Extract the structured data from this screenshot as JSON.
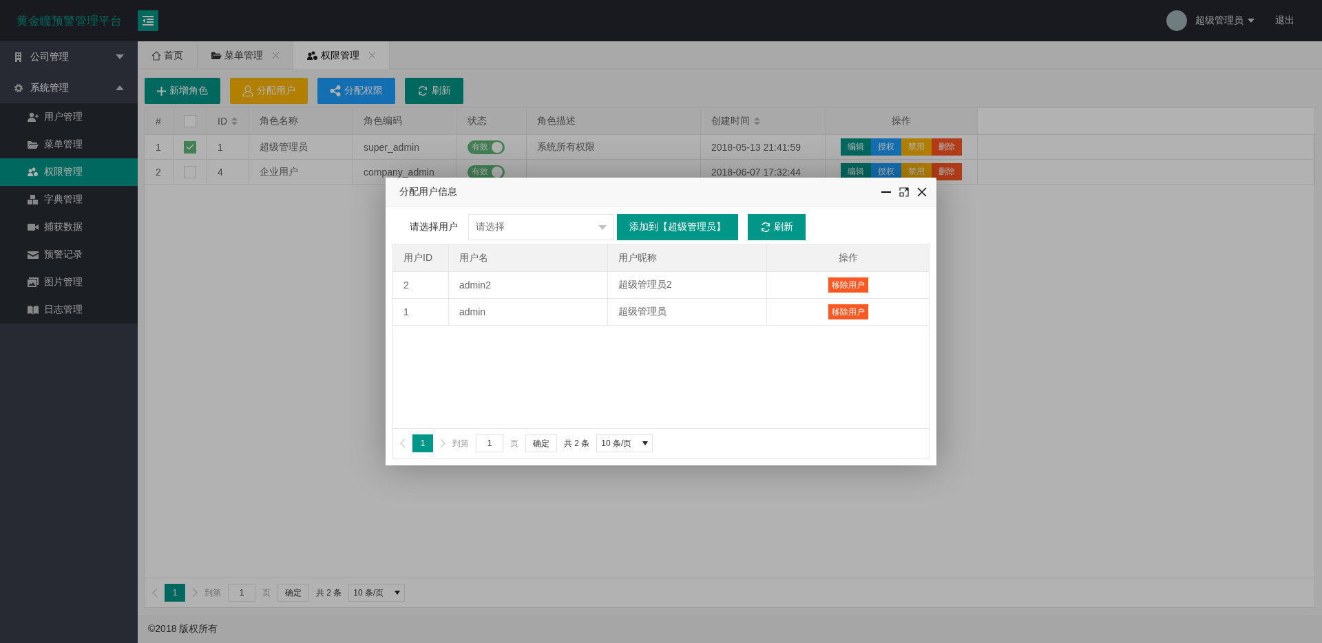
{
  "app": {
    "title": "黄金瞳预警管理平台"
  },
  "user": {
    "name": "超级管理员",
    "logout": "退出"
  },
  "sidebar": {
    "items": [
      {
        "label": "公司管理",
        "expanded": false
      },
      {
        "label": "系统管理",
        "expanded": true,
        "children": [
          {
            "label": "用户管理",
            "selected": false
          },
          {
            "label": "菜单管理",
            "selected": false
          },
          {
            "label": "权限管理",
            "selected": true
          },
          {
            "label": "字典管理",
            "selected": false
          },
          {
            "label": "捕获数据",
            "selected": false
          },
          {
            "label": "预警记录",
            "selected": false
          },
          {
            "label": "图片管理",
            "selected": false
          },
          {
            "label": "日志管理",
            "selected": false
          }
        ]
      }
    ]
  },
  "tabs": [
    {
      "label": "首页",
      "closable": false,
      "selected": false
    },
    {
      "label": "菜单管理",
      "closable": true,
      "selected": false
    },
    {
      "label": "权限管理",
      "closable": true,
      "selected": true
    }
  ],
  "toolbar": [
    {
      "label": "新增角色",
      "kind": "primary"
    },
    {
      "label": "分配用户",
      "kind": "warm"
    },
    {
      "label": "分配权限",
      "kind": "normal"
    },
    {
      "label": "刷新",
      "kind": "primary"
    }
  ],
  "table": {
    "header_checked": false,
    "columns": [
      {
        "label": "#",
        "sortable": false
      },
      {
        "label": "ID",
        "sortable": true
      },
      {
        "label": "角色名称",
        "sortable": false
      },
      {
        "label": "角色编码",
        "sortable": false
      },
      {
        "label": "状态",
        "sortable": false
      },
      {
        "label": "角色描述",
        "sortable": false
      },
      {
        "label": "创建时间",
        "sortable": true
      },
      {
        "label": "操作",
        "sortable": false
      }
    ],
    "rows": [
      {
        "no": "1",
        "checked": true,
        "id": "1",
        "name": "超级管理员",
        "code": "super_admin",
        "status": {
          "label": "有效",
          "on": true
        },
        "description": "系统所有权限",
        "created": "2018-05-13 21:41:59",
        "actions": [
          "编辑",
          "授权",
          "禁用",
          "删除"
        ]
      },
      {
        "no": "2",
        "checked": false,
        "id": "4",
        "name": "企业用户",
        "code": "company_admin",
        "status": {
          "label": "有效",
          "on": true
        },
        "created": "2018-06-07 17:32:44",
        "actions": [
          "编辑",
          "授权",
          "禁用",
          "删除"
        ]
      }
    ],
    "pager": {
      "page": "1",
      "goto": "到第",
      "input": "1",
      "unit": "页",
      "confirm": "确定",
      "total": "共 2 条",
      "size": "10 条/页"
    }
  },
  "footer": "©2018 版权所有",
  "dialog": {
    "title": "分配用户信息",
    "select_label": "请选择用户",
    "select": {
      "placeholder": "请选择"
    },
    "add_button": "添加到【超级管理员】",
    "refresh_button": "刷新",
    "columns": [
      "用户ID",
      "用户名",
      "用户昵称",
      "操作"
    ],
    "rows": [
      {
        "id": "2",
        "username": "admin2",
        "nickname": "超级管理员2",
        "action": "移除用户"
      },
      {
        "id": "1",
        "username": "admin",
        "nickname": "超级管理员",
        "action": "移除用户"
      }
    ],
    "pager": {
      "page": "1",
      "goto": "到第",
      "input": "1",
      "unit": "页",
      "confirm": "确定",
      "total": "共 2 条",
      "size": "10 条/页"
    }
  }
}
